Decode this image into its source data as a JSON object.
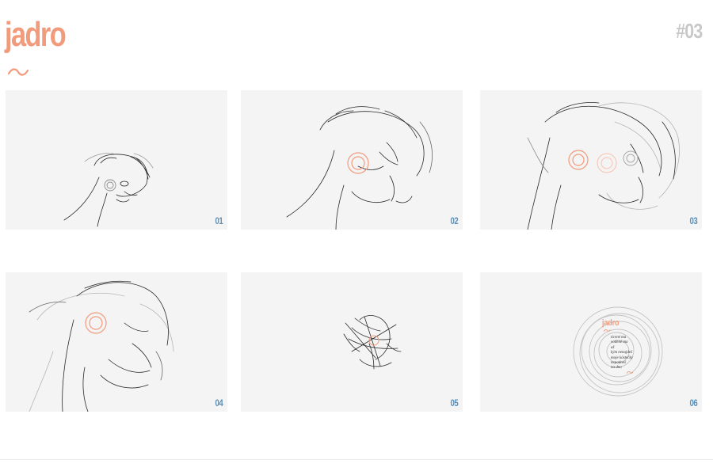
{
  "header": {
    "title": "jadro",
    "number": "#03"
  },
  "colors": {
    "accent": "#f29a7c",
    "frame_number": "#5a8fb8",
    "page_number": "#c8c8c8",
    "frame_bg": "#f4f4f4",
    "sketch": "#2a2a2a"
  },
  "frames": [
    {
      "number": "01",
      "description": "small sketched head"
    },
    {
      "number": "02",
      "description": "large tilted face with circle"
    },
    {
      "number": "03",
      "description": "overlapping faces with circles"
    },
    {
      "number": "04",
      "description": "layered faces with circle"
    },
    {
      "number": "05",
      "description": "tangled collapsed face"
    },
    {
      "number": "06",
      "description": "concentric rings with poem"
    }
  ],
  "poem": {
    "title": "jadro",
    "lines": [
      "ticené ma",
      "vodené ma",
      "až",
      "kým nenajdeš",
      "moje kôstečky",
      "nepadneš",
      "na dno"
    ]
  }
}
